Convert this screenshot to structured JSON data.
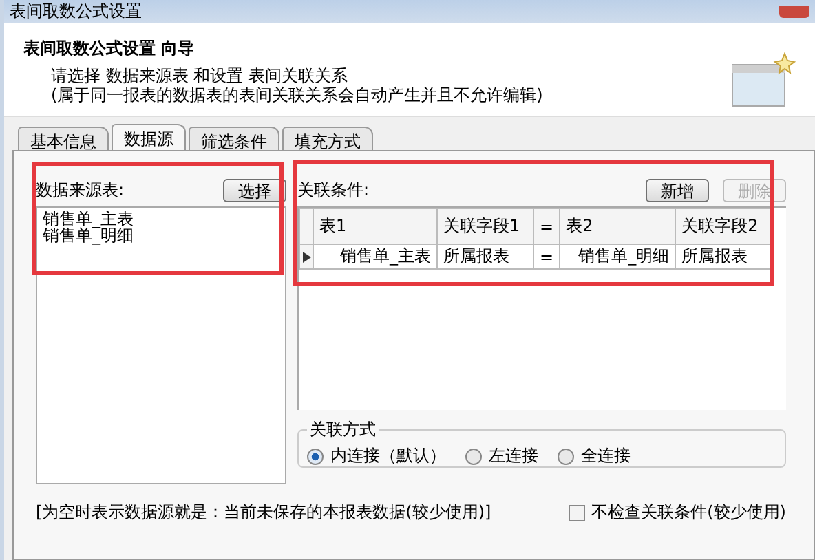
{
  "window": {
    "title": "表间取数公式设置"
  },
  "header": {
    "title": "表间取数公式设置 向导",
    "lines": [
      "请选择 数据来源表 和设置 表间关联关系",
      "(属于同一报表的数据表的表间关联关系会自动产生并且不允许编辑)"
    ]
  },
  "tabs": [
    {
      "label": "基本信息",
      "selected": false
    },
    {
      "label": "数据源",
      "selected": true
    },
    {
      "label": "筛选条件",
      "selected": false
    },
    {
      "label": "填充方式",
      "selected": false
    }
  ],
  "source": {
    "label": "数据来源表:",
    "button": "选择",
    "items": [
      "销售单_主表",
      "销售单_明细"
    ]
  },
  "relations": {
    "label": "关联条件:",
    "buttons": [
      {
        "label": "新增",
        "disabled": false
      },
      {
        "label": "删除",
        "disabled": true
      }
    ],
    "columns": [
      "表1",
      "关联字段1",
      "=",
      "表2",
      "关联字段2"
    ],
    "rows": [
      {
        "selected": true,
        "cells": [
          "销售单_主表",
          "所属报表",
          "=",
          "销售单_明细",
          "所属报表"
        ]
      }
    ]
  },
  "join": {
    "title": "关联方式",
    "options": [
      {
        "label": "内连接（默认）",
        "selected": true
      },
      {
        "label": "左连接",
        "selected": false
      },
      {
        "label": "全连接",
        "selected": false
      }
    ]
  },
  "footer_note": "[为空时表示数据源就是：当前未保存的本报表数据(较少使用)]",
  "skip_check": {
    "label": "不检查关联条件(较少使用)",
    "checked": false
  }
}
